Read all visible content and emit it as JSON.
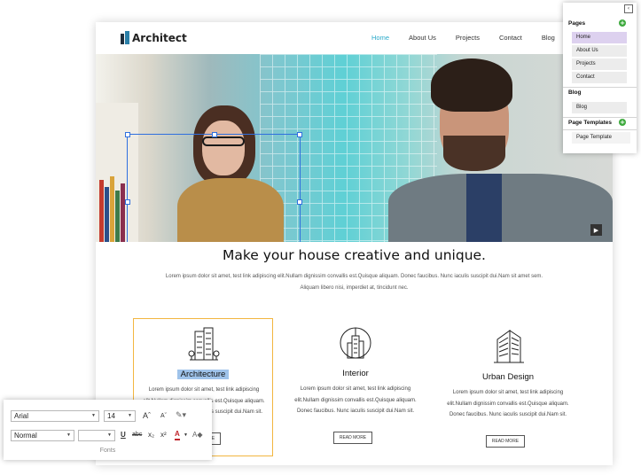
{
  "site": {
    "logo_text": "Architect",
    "nav": [
      "Home",
      "About Us",
      "Projects",
      "Contact",
      "Blog"
    ],
    "active_nav": "Home",
    "headline": "Make your house creative and unique.",
    "lead": "Lorem ipsum dolor sit amet, test link adipiscing elit.Nullam dignissim convallis est.Quisque aliquam. Donec faucibus. Nunc iaculis suscipit dui.Nam sit amet sem. Aliquam libero nisi, imperdiet at, tincidunt nec.",
    "features": [
      {
        "title": "Architecture",
        "icon": "skyscraper-icon",
        "desc": "Lorem ipsum dolor sit amet, test link adipiscing elit.Nullam dignissim convallis est.Quisque aliquam. Donec faucibus. Nunc iaculis suscipit dui.Nam sit.",
        "button": "READ MORE"
      },
      {
        "title": "Interior",
        "icon": "tower-circle-icon",
        "desc": "Lorem ipsum dolor sit amet, test link adipiscing elit.Nullam dignissim convallis est.Quisque aliquam. Donec faucibus. Nunc iaculis suscipit dui.Nam sit.",
        "button": "READ MORE"
      },
      {
        "title": "Urban Design",
        "icon": "building-perspective-icon",
        "desc": "Lorem ipsum dolor sit amet, test link adipiscing elit.Nullam dignissim convallis est.Quisque aliquam. Donec faucibus. Nunc iaculis suscipit dui.Nam sit.",
        "button": "READ MORE"
      }
    ]
  },
  "panel": {
    "pages_heading": "Pages",
    "pages": [
      "Home",
      "About Us",
      "Projects",
      "Contact"
    ],
    "blog_heading": "Blog",
    "blog_items": [
      "Blog"
    ],
    "templates_heading": "Page Templates",
    "template_items": [
      "Page Template"
    ]
  },
  "toolbar": {
    "font_family": "Arial",
    "font_size": "14",
    "paragraph_style": "Normal",
    "line_height": "",
    "group_label": "Fonts"
  },
  "colors": {
    "accent": "#29a9c9",
    "selection": "#2f6fde",
    "highlight_border": "#f2b640",
    "add_green": "#3da93d"
  }
}
